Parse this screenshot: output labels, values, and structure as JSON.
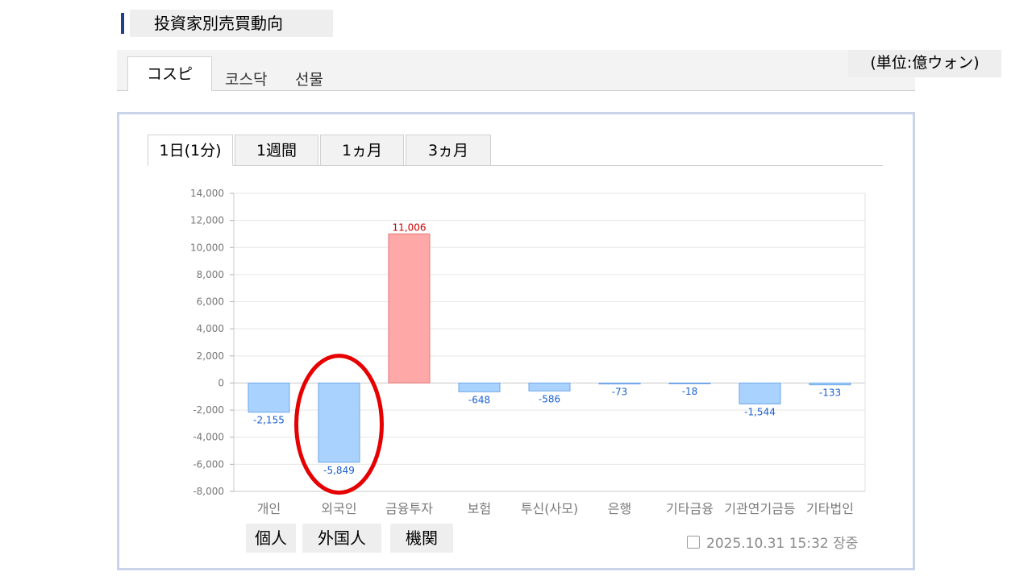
{
  "header": {
    "title": "投資家別売買動向"
  },
  "market_tabs": [
    {
      "label": "コスピ",
      "active": true
    },
    {
      "label": "코스닥",
      "active": false
    },
    {
      "label": "선물",
      "active": false
    }
  ],
  "unit_label": "(単位:億ウォン)",
  "period_tabs": [
    {
      "label": "1日(1分)",
      "active": true
    },
    {
      "label": "1週間",
      "active": false
    },
    {
      "label": "1ヵ月",
      "active": false
    },
    {
      "label": "3ヵ月",
      "active": false
    }
  ],
  "annotations": {
    "jp_labels": [
      "個人",
      "外国人",
      "機関"
    ],
    "highlight_color": "#e60000"
  },
  "timestamp": "2025.10.31 15:32 장중",
  "colors": {
    "positive_fill": "#ffa8a8",
    "negative_fill": "#aad2ff",
    "positive_text": "#cc0000",
    "negative_text": "#1a5fd0"
  },
  "chart_data": {
    "type": "bar",
    "categories": [
      "개인",
      "외국인",
      "금융투자",
      "보험",
      "투신(사모)",
      "은행",
      "기타금융",
      "기관연기금등",
      "기타법인"
    ],
    "values": [
      -2155,
      -5849,
      11006,
      -648,
      -586,
      -73,
      -18,
      -1544,
      -133
    ],
    "data_labels": [
      "-2,155",
      "-5,849",
      "11,006",
      "-648",
      "-586",
      "-73",
      "-18",
      "-1,544",
      "-133"
    ],
    "ylim": [
      -8000,
      14000
    ],
    "yticks": [
      14000,
      12000,
      10000,
      8000,
      6000,
      4000,
      2000,
      0,
      -2000,
      -4000,
      -6000,
      -8000
    ],
    "ytick_labels": [
      "14,000",
      "12,000",
      "10,000",
      "8,000",
      "6,000",
      "4,000",
      "2,000",
      "0",
      "-2,000",
      "-4,000",
      "-6,000",
      "-8,000"
    ],
    "grid": true
  }
}
